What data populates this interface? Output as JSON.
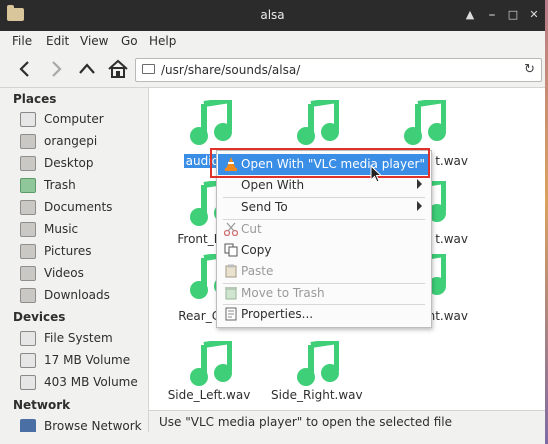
{
  "window": {
    "title": "alsa"
  },
  "menubar": [
    "File",
    "Edit",
    "View",
    "Go",
    "Help"
  ],
  "toolbar": {
    "address": "/usr/share/sounds/alsa/",
    "buttons": [
      "back",
      "forward",
      "up",
      "home"
    ]
  },
  "sidebar": {
    "places_title": "Places",
    "places": [
      {
        "label": "Computer",
        "icon": "computer-icon"
      },
      {
        "label": "orangepi",
        "icon": "home-folder-icon"
      },
      {
        "label": "Desktop",
        "icon": "desktop-folder-icon"
      },
      {
        "label": "Trash",
        "icon": "trash-icon"
      },
      {
        "label": "Documents",
        "icon": "documents-folder-icon"
      },
      {
        "label": "Music",
        "icon": "music-folder-icon"
      },
      {
        "label": "Pictures",
        "icon": "pictures-folder-icon"
      },
      {
        "label": "Videos",
        "icon": "videos-folder-icon"
      },
      {
        "label": "Downloads",
        "icon": "downloads-folder-icon"
      }
    ],
    "devices_title": "Devices",
    "devices": [
      {
        "label": "File System",
        "icon": "drive-icon"
      },
      {
        "label": "17 MB Volume",
        "icon": "drive-icon"
      },
      {
        "label": "403 MB Volume",
        "icon": "drive-icon"
      }
    ],
    "network_title": "Network",
    "network": [
      {
        "label": "Browse Network",
        "icon": "network-icon"
      }
    ]
  },
  "files": [
    {
      "name": "audio.w"
    },
    {
      "name": ""
    },
    {
      "name": "t.wav"
    },
    {
      "name": "Front_Righ"
    },
    {
      "name": ""
    },
    {
      "name": "t.wav"
    },
    {
      "name": "Rear_Cent"
    },
    {
      "name": ""
    },
    {
      "name": "ght.wav"
    },
    {
      "name": "Side_Left.wav"
    },
    {
      "name": "Side_Right.wav"
    }
  ],
  "context_menu": {
    "items": [
      {
        "label": "Open With \"VLC media player\"",
        "icon": "vlc-icon",
        "highlighted": true
      },
      {
        "label": "Open With",
        "submenu": true
      },
      {
        "label": "Send To",
        "submenu": true
      },
      {
        "label": "Cut",
        "icon": "cut-icon",
        "disabled": true
      },
      {
        "label": "Copy",
        "icon": "copy-icon"
      },
      {
        "label": "Paste",
        "icon": "paste-icon",
        "disabled": true
      },
      {
        "label": "Move to Trash",
        "icon": "trash-icon",
        "disabled": true
      },
      {
        "label": "Properties...",
        "icon": "properties-icon"
      }
    ]
  },
  "status": {
    "text": "Use \"VLC media player\" to open the selected file"
  },
  "colors": {
    "accent": "#3a8ee6",
    "music_icon": "#3fcf78",
    "highlight_box": "#e0302a"
  }
}
